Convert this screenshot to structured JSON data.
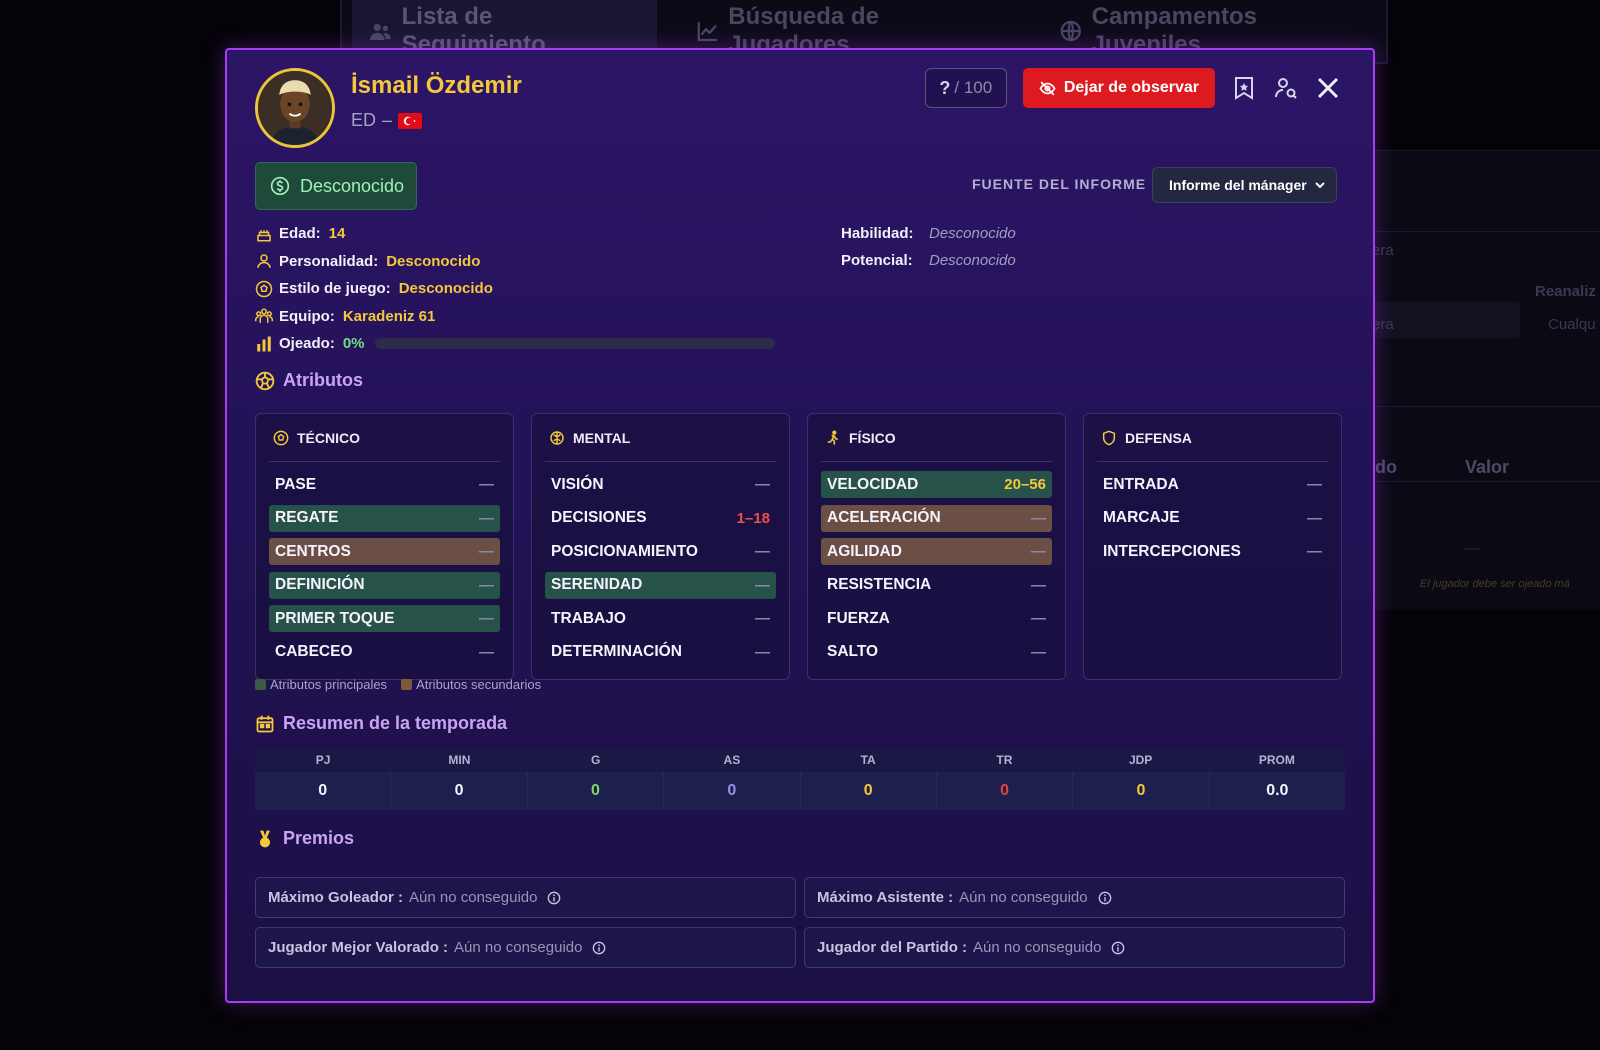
{
  "background": {
    "tabs": [
      {
        "label": "Lista de Seguimiento",
        "icon": "users-icon"
      },
      {
        "label": "Búsqueda de Jugadores",
        "icon": "chart-icon"
      },
      {
        "label": "Campamentos Juveniles",
        "icon": "globe-icon"
      }
    ],
    "fragments": {
      "era_top": "era",
      "reanaliz": "Reanaliz",
      "era_select": "era",
      "cualqu": "Cualqu",
      "do_col": "do",
      "valor_col": "Valor",
      "warning": "El jugador debe ser ojeado má",
      "dash": "—"
    }
  },
  "player": {
    "name": "İsmail Özdemir",
    "position": "ED",
    "separator": "–",
    "nationality": "Turkey"
  },
  "header": {
    "score_q": "?",
    "score_total": "/ 100",
    "unwatch_label": "Dejar de observar"
  },
  "status": {
    "label": "Desconocido"
  },
  "report": {
    "label": "FUENTE DEL INFORME",
    "selected": "Informe del mánager"
  },
  "info": {
    "age_label": "Edad:",
    "age": "14",
    "personality_label": "Personalidad:",
    "personality": "Desconocido",
    "style_label": "Estilo de juego:",
    "style": "Desconocido",
    "team_label": "Equipo:",
    "team": "Karadeniz 61",
    "scouted_label": "Ojeado:",
    "scouted": "0%",
    "scouted_fraction": 0
  },
  "ability": {
    "skill_label": "Habilidad:",
    "skill": "Desconocido",
    "potential_label": "Potencial:",
    "potential": "Desconocido"
  },
  "sections": {
    "attributes": "Atributos",
    "season": "Resumen de la temporada",
    "awards": "Premios"
  },
  "attributes": {
    "tecnico": {
      "title": "TÉCNICO",
      "rows": [
        {
          "name": "PASE",
          "value": "—",
          "kind": "none"
        },
        {
          "name": "REGATE",
          "value": "—",
          "kind": "primary"
        },
        {
          "name": "CENTROS",
          "value": "—",
          "kind": "secondary"
        },
        {
          "name": "DEFINICIÓN",
          "value": "—",
          "kind": "primary"
        },
        {
          "name": "PRIMER TOQUE",
          "value": "—",
          "kind": "primary"
        },
        {
          "name": "CABECEO",
          "value": "—",
          "kind": "none"
        }
      ]
    },
    "mental": {
      "title": "MENTAL",
      "rows": [
        {
          "name": "VISIÓN",
          "value": "—",
          "kind": "none"
        },
        {
          "name": "DECISIONES",
          "value": "1–18",
          "kind": "none"
        },
        {
          "name": "POSICIONAMIENTO",
          "value": "—",
          "kind": "none"
        },
        {
          "name": "SERENIDAD",
          "value": "—",
          "kind": "primary"
        },
        {
          "name": "TRABAJO",
          "value": "—",
          "kind": "none"
        },
        {
          "name": "DETERMINACIÓN",
          "value": "—",
          "kind": "none"
        }
      ]
    },
    "fisico": {
      "title": "FÍSICO",
      "rows": [
        {
          "name": "VELOCIDAD",
          "value": "20–56",
          "kind": "primary"
        },
        {
          "name": "ACELERACIÓN",
          "value": "—",
          "kind": "secondary"
        },
        {
          "name": "AGILIDAD",
          "value": "—",
          "kind": "secondary"
        },
        {
          "name": "RESISTENCIA",
          "value": "—",
          "kind": "none"
        },
        {
          "name": "FUERZA",
          "value": "—",
          "kind": "none"
        },
        {
          "name": "SALTO",
          "value": "—",
          "kind": "none"
        }
      ]
    },
    "defensa": {
      "title": "DEFENSA",
      "rows": [
        {
          "name": "ENTRADA",
          "value": "—",
          "kind": "none"
        },
        {
          "name": "MARCAJE",
          "value": "—",
          "kind": "none"
        },
        {
          "name": "INTERCEPCIONES",
          "value": "—",
          "kind": "none"
        }
      ]
    }
  },
  "legend": {
    "primary": "Atributos principales",
    "secondary": "Atributos secundarios"
  },
  "season": {
    "headers": [
      "PJ",
      "MIN",
      "G",
      "AS",
      "TA",
      "TR",
      "JDP",
      "PROM"
    ],
    "values": [
      "0",
      "0",
      "0",
      "0",
      "0",
      "0",
      "0",
      "0.0"
    ],
    "value_colors": [
      "#f4f2fa",
      "#f4f2fa",
      "#7fd66a",
      "#9b8fe0",
      "#f3c93a",
      "#e0453f",
      "#f3c93a",
      "#f4f2fa"
    ]
  },
  "awards": [
    {
      "label": "Máximo Goleador :",
      "value": "Aún no conseguido"
    },
    {
      "label": "Máximo Asistente :",
      "value": "Aún no conseguido"
    },
    {
      "label": "Jugador Mejor Valorado :",
      "value": "Aún no conseguido"
    },
    {
      "label": "Jugador del Partido :",
      "value": "Aún no conseguido"
    }
  ],
  "colors": {
    "accent_gold": "#f3c93a",
    "modal_border": "#a73cf0",
    "primary_attr": "#27524a",
    "secondary_attr": "#6b4f45",
    "danger": "#dc1a1f"
  }
}
